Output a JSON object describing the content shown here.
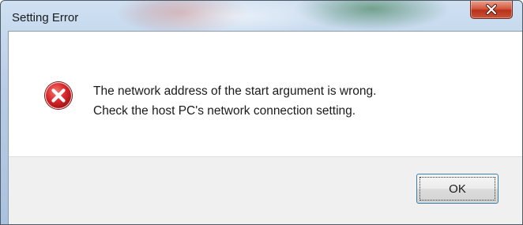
{
  "dialog": {
    "title": "Setting Error",
    "close_icon": "close-icon",
    "icon": "error-icon",
    "message_line1": "The network address of the start argument is wrong.",
    "message_line2": "Check the host PC's network connection setting.",
    "ok_label": "OK"
  },
  "colors": {
    "error_red": "#d8262a",
    "close_button": "#c9452d",
    "focus_border": "#3c7fb1"
  }
}
